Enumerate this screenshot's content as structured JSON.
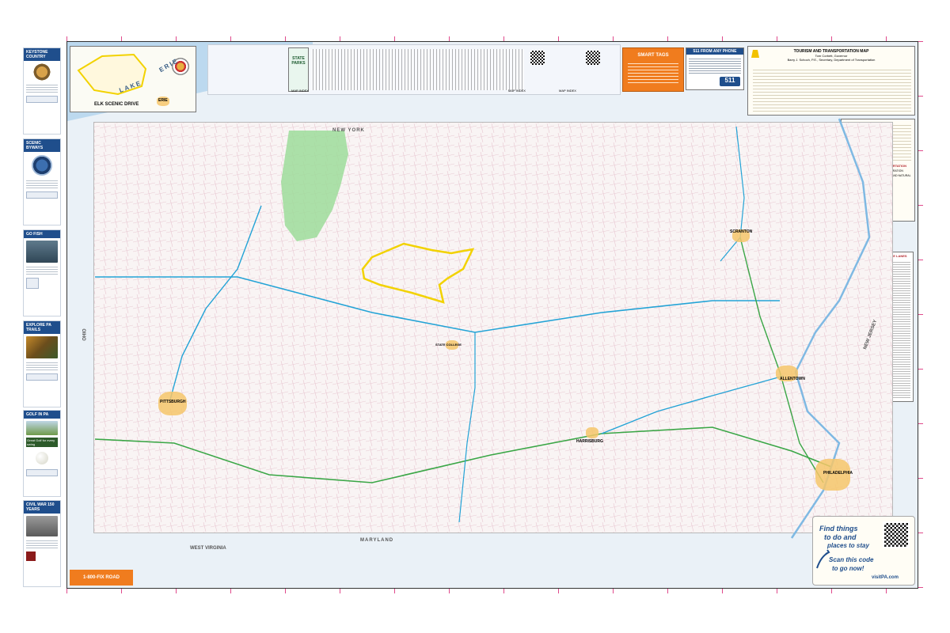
{
  "sidebar": {
    "panels": [
      {
        "title": "KEYSTONE COUNTRY"
      },
      {
        "title": "SCENIC BYWAYS"
      },
      {
        "title": "GO FISH"
      },
      {
        "title": "EXPLORE PA TRAILS"
      },
      {
        "title": "GOLF IN PA",
        "tagline": "Great Golf for every swing"
      },
      {
        "title": "CIVIL WAR 150 YEARS"
      }
    ]
  },
  "map": {
    "inset_label": "ELK SCENIC DRIVE",
    "lake_label": "LAKE",
    "lake_label2": "ERIE",
    "parks_title": "STATE PARKS",
    "map_index_labels": [
      "MAP INDEX",
      "MAP INDEX",
      "MAP INDEX"
    ],
    "smart_tags_title": "SMART TAGS",
    "phone511_title": "511 FROM ANY PHONE",
    "phone511_logo": "511",
    "title_block": {
      "title": "TOURISM AND TRANSPORTATION MAP",
      "governor": "Tom Corbett, Governor",
      "secretary": "Barry J. Schoch, P.E., Secretary, Department of Transportation"
    },
    "agency_block": {
      "dept": "DEPARTMENT OF TRANSPORTATION",
      "fhwa": "FEDERAL HIGHWAY ADMINISTRATION",
      "dcnr": "DEPARTMENT OF CONSERVATION AND NATURAL RESOURCES"
    },
    "lakes_title": "STATE LAKE LANES",
    "state_labels": {
      "new_york": "NEW YORK",
      "ohio": "OHIO",
      "maryland": "MARYLAND",
      "west_virginia": "WEST VIRGINIA",
      "new_jersey": "NEW JERSEY"
    },
    "cities": [
      {
        "name": "PITTSBURGH"
      },
      {
        "name": "PHILADELPHIA"
      },
      {
        "name": "ALLENTOWN"
      },
      {
        "name": "HARRISBURG"
      },
      {
        "name": "SCRANTON"
      },
      {
        "name": "ERIE"
      },
      {
        "name": "STATE COLLEGE"
      }
    ],
    "promo": {
      "line1": "Find things",
      "line2": "to do and",
      "line3": "places to stay",
      "line4": "Scan this code",
      "line5": "to go now!",
      "site": "visitPA.com"
    },
    "fix_road": {
      "headline": "1-800-FIX ROAD"
    }
  },
  "colors": {
    "sidebar_head": "#1f4e8c",
    "frame_bg": "#eaf1f7",
    "state_bg": "#f9f4f4",
    "forest": "#9ddc9a",
    "byway_yellow": "#f2d200",
    "smart_tags_orange": "#f07c1e"
  },
  "icons": [
    "qr-code-icon",
    "compass-rose-icon",
    "511-logo-icon",
    "keystone-logo-icon"
  ]
}
